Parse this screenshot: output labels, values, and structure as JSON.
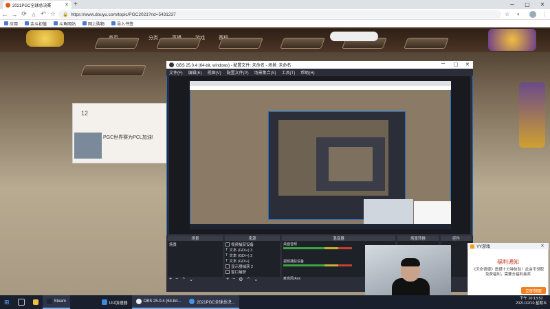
{
  "browser": {
    "tab_title": "2021PGC全球总决赛",
    "url": "https://www.douyu.com/topic/PGC2021?rid=5431237",
    "bookmarks": [
      "应用",
      "余斗初值",
      "斗鱼网站",
      "网上购物",
      "导入书签"
    ]
  },
  "site": {
    "top_links": [
      "首页",
      "分类",
      "直播",
      "游戏",
      "赛程"
    ],
    "stream_count": "12",
    "stream_title": "PGC世界赛为PCL加油!"
  },
  "obs": {
    "title": "OBS 25.0.4 (64-bit, windows) - 配置文件: 未命名 - 场景: 未命名",
    "menu": [
      "文件(F)",
      "编辑(E)",
      "视图(V)",
      "配置文件(P)",
      "场景集合(S)",
      "工具(T)",
      "帮助(H)"
    ],
    "docks": [
      "场景",
      "来源",
      "混音器",
      "场景转换",
      "控件"
    ],
    "scene": "场景",
    "sources": [
      "视频捕获设备",
      "文本 (GDI+) 3",
      "文本 (GDI+) 2",
      "文本 (GDI+)",
      "显示器捕获 2",
      "窗口捕获"
    ],
    "mixer": [
      "桌面音频",
      "视频捕获设备",
      "麦克风/Aux"
    ]
  },
  "notification": {
    "header": "YY游戏",
    "title": "福利通知",
    "text": "《天命奇御》震撼十分钟体验！此金币领取免费福利，需要去福利抽奖",
    "button": "立即领取"
  },
  "taskbar": {
    "items": [
      "Steam",
      "UU加速器",
      "OBS 25.0.4 (64-bit...",
      "2021PGC全球总决..."
    ],
    "time": "下午 10:13:52",
    "date": "2021/12/10 星期五"
  }
}
